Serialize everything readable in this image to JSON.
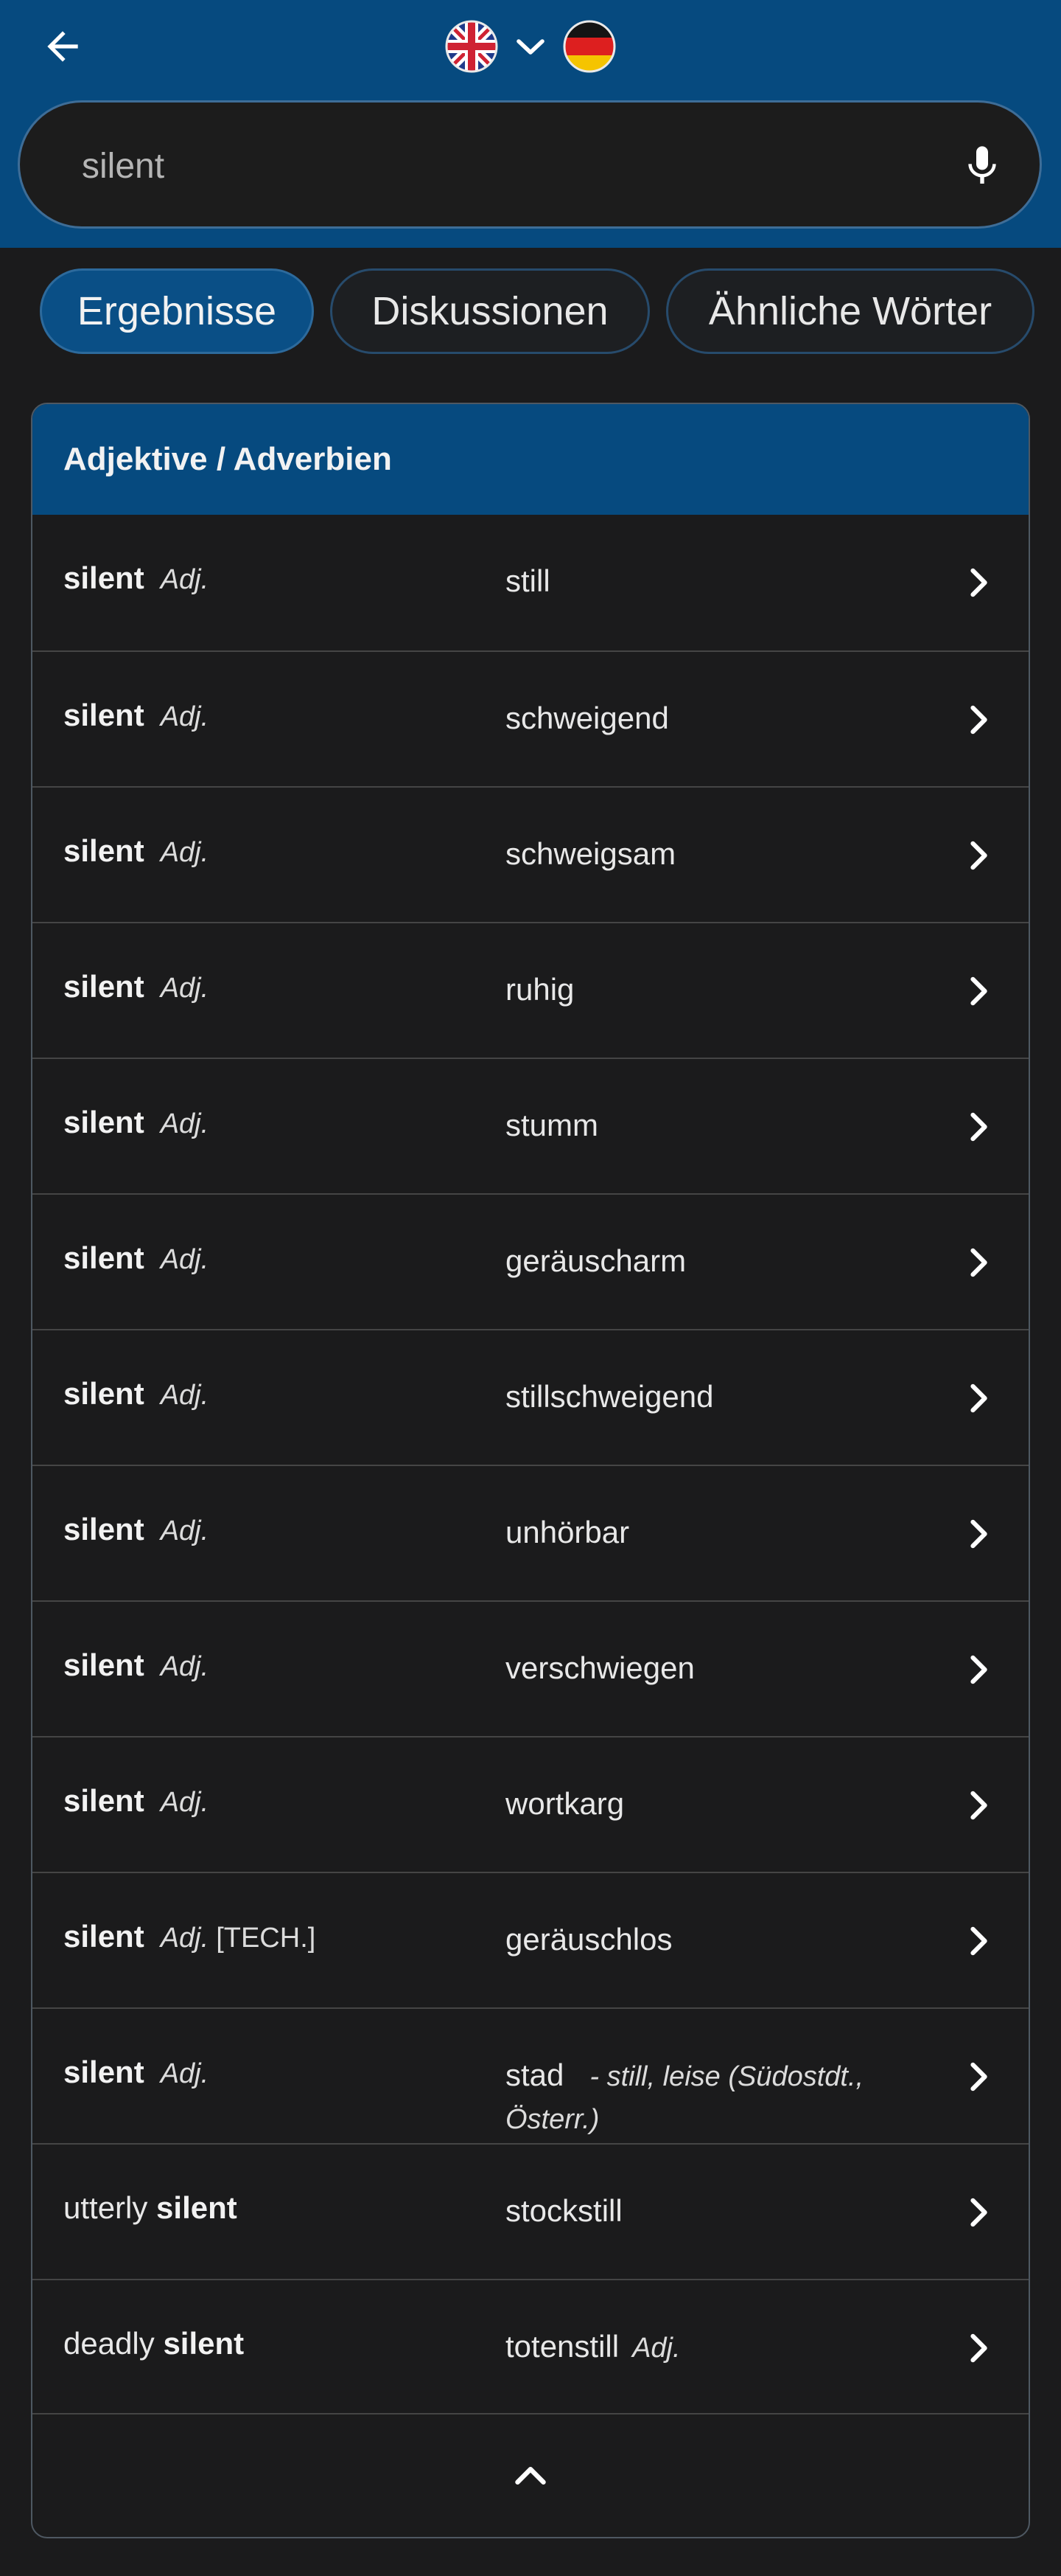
{
  "header": {
    "background": "#064a7f",
    "back_icon": "arrow-left-icon",
    "source_flag": "united-kingdom-flag-icon",
    "target_flag": "germany-flag-icon",
    "switch_icon": "chevron-down-icon"
  },
  "search": {
    "value": "silent",
    "mic_icon": "microphone-icon"
  },
  "tabs": [
    {
      "label": "Ergebnisse",
      "active": true
    },
    {
      "label": "Diskussionen",
      "active": false
    },
    {
      "label": "Ähnliche Wörter",
      "active": false
    }
  ],
  "results": {
    "section_title": "Adjektive / Adverbien",
    "rows": [
      {
        "prefix": "",
        "word": "silent",
        "tag": "Adj.",
        "extra": "",
        "translation": "still",
        "translation_tag": "",
        "note": ""
      },
      {
        "prefix": "",
        "word": "silent",
        "tag": "Adj.",
        "extra": "",
        "translation": "schweigend",
        "translation_tag": "",
        "note": ""
      },
      {
        "prefix": "",
        "word": "silent",
        "tag": "Adj.",
        "extra": "",
        "translation": "schweigsam",
        "translation_tag": "",
        "note": ""
      },
      {
        "prefix": "",
        "word": "silent",
        "tag": "Adj.",
        "extra": "",
        "translation": "ruhig",
        "translation_tag": "",
        "note": ""
      },
      {
        "prefix": "",
        "word": "silent",
        "tag": "Adj.",
        "extra": "",
        "translation": "stumm",
        "translation_tag": "",
        "note": ""
      },
      {
        "prefix": "",
        "word": "silent",
        "tag": "Adj.",
        "extra": "",
        "translation": "geräuscharm",
        "translation_tag": "",
        "note": ""
      },
      {
        "prefix": "",
        "word": "silent",
        "tag": "Adj.",
        "extra": "",
        "translation": "stillschweigend",
        "translation_tag": "",
        "note": ""
      },
      {
        "prefix": "",
        "word": "silent",
        "tag": "Adj.",
        "extra": "",
        "translation": "unhörbar",
        "translation_tag": "",
        "note": ""
      },
      {
        "prefix": "",
        "word": "silent",
        "tag": "Adj.",
        "extra": "",
        "translation": "verschwiegen",
        "translation_tag": "",
        "note": ""
      },
      {
        "prefix": "",
        "word": "silent",
        "tag": "Adj.",
        "extra": "",
        "translation": "wortkarg",
        "translation_tag": "",
        "note": ""
      },
      {
        "prefix": "",
        "word": "silent",
        "tag": "Adj.",
        "extra": "[TECH.]",
        "translation": "geräuschlos",
        "translation_tag": "",
        "note": ""
      },
      {
        "prefix": "",
        "word": "silent",
        "tag": "Adj.",
        "extra": "",
        "translation": "stad",
        "translation_tag": "",
        "note": "- still, leise (Südostdt., Österr.)"
      },
      {
        "prefix": "utterly",
        "word": "silent",
        "tag": "",
        "extra": "",
        "translation": "stockstill",
        "translation_tag": "",
        "note": ""
      },
      {
        "prefix": "deadly",
        "word": "silent",
        "tag": "",
        "extra": "",
        "translation": "totenstill",
        "translation_tag": "Adj.",
        "note": ""
      }
    ],
    "row_icon": "chevron-right-icon",
    "collapse_icon": "chevron-up-icon"
  }
}
